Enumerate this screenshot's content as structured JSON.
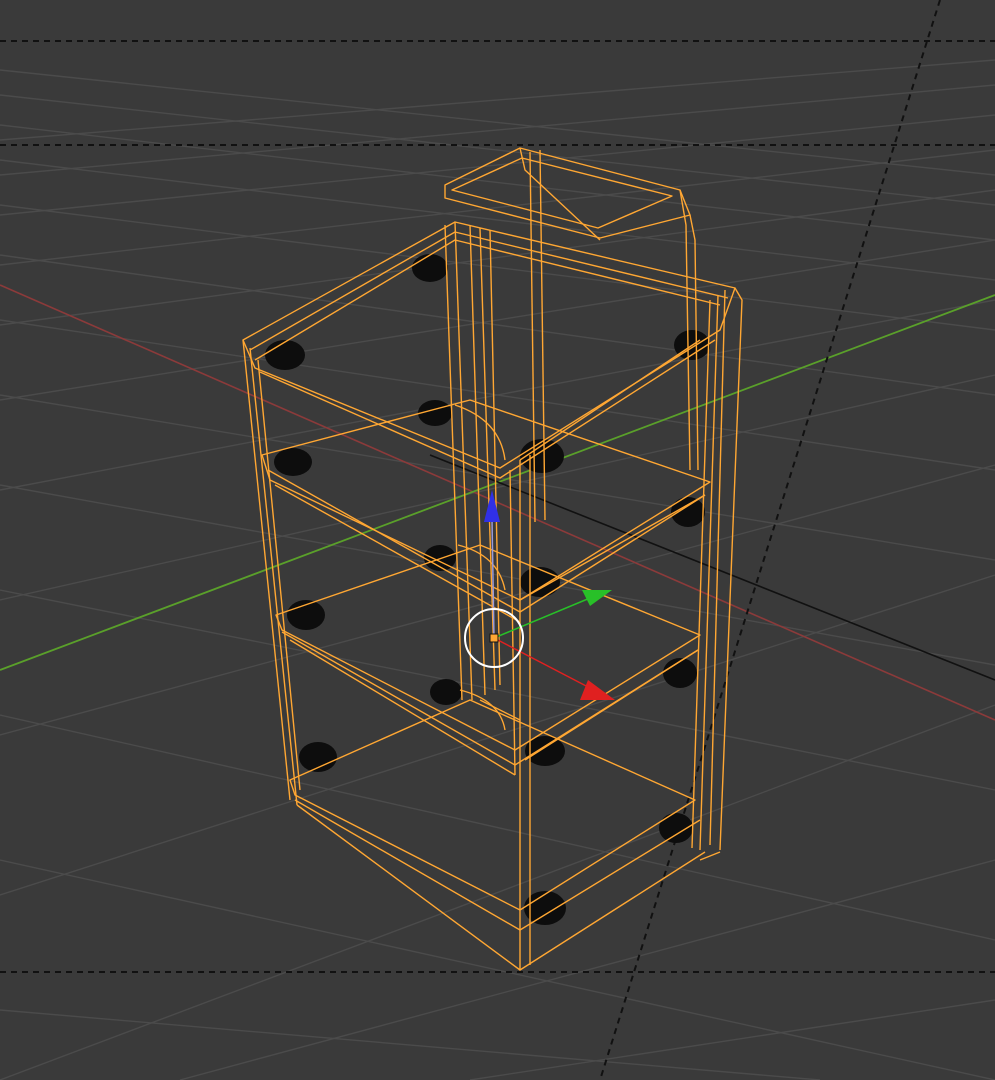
{
  "viewport": {
    "name": "3D Viewport",
    "shading_mode": "wireframe",
    "colors": {
      "background": "#3a3a3a",
      "grid": "#4b4b4b",
      "x_axis": "#8c3a3a",
      "y_axis": "#5aa02a",
      "camera_frame": "#111111",
      "selection": "#ffa733",
      "wheel": "#0d0d0d",
      "gizmo_x": "#e02020",
      "gizmo_y": "#28c028",
      "gizmo_z": "#3030e6",
      "pivot_circle": "#ffffff"
    }
  },
  "selected_object": {
    "type": "wireframe-cart",
    "state": "selected"
  },
  "transform_gizmo": {
    "mode": "translate",
    "axes": [
      "x",
      "y",
      "z"
    ]
  }
}
